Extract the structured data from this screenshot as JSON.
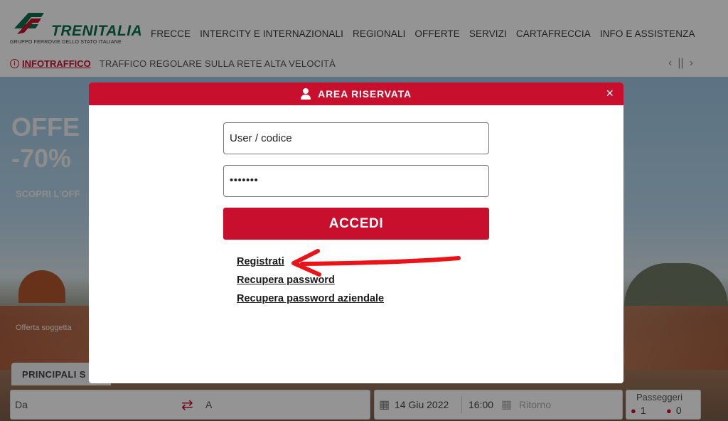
{
  "brand": {
    "name": "TRENITALIA",
    "subtitle": "GRUPPO FERROVIE DELLO STATO ITALIANE"
  },
  "nav": [
    "FRECCE",
    "INTERCITY E INTERNAZIONALI",
    "REGIONALI",
    "OFFERTE",
    "SERVIZI",
    "CARTAFRECCIA",
    "INFO E ASSISTENZA"
  ],
  "infobar": {
    "link": "INFOTRAFFICO",
    "text": "TRAFFICO REGOLARE SULLA RETE ALTA VELOCITÀ"
  },
  "hero": {
    "title1": "OFFE",
    "title2": "-70%",
    "cta": "SCOPRI L'OFF",
    "note": "Offerta soggetta"
  },
  "tab": {
    "label": "PRINCIPALI S"
  },
  "search": {
    "from_label": "Da",
    "to_label": "A",
    "date": "14 Giu 2022",
    "time": "16:00",
    "return_label": "Ritorno",
    "passengers_label": "Passeggeri",
    "adults": "1",
    "children": "0"
  },
  "modal": {
    "title": "AREA RISERVATA",
    "close": "×",
    "user_value": "User / codice",
    "password_value": "•••••••",
    "submit": "ACCEDI",
    "links": [
      "Registrati",
      "Recupera password",
      "Recupera password aziendale"
    ]
  },
  "colors": {
    "brand_red": "#c8102e",
    "brand_green": "#0b6e4f"
  },
  "icons": {
    "user": "user-icon",
    "close": "close-icon",
    "info": "info-icon",
    "swap": "swap-arrows-icon",
    "calendar": "calendar-icon",
    "arrow_annotation": "red-arrow-annotation"
  }
}
